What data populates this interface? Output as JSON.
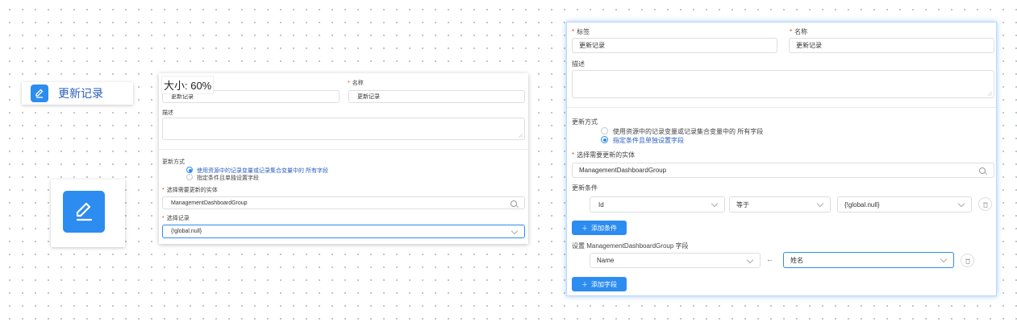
{
  "node_pill": {
    "label": "更新记录",
    "icon": "edit-icon"
  },
  "node_big": {
    "icon": "edit-icon"
  },
  "preview": {
    "zoom_label": "大小: 60%",
    "name_label": "名称",
    "label_value": "更新记录",
    "name_value": "更新记录",
    "description_label": "描述",
    "update_method_label": "更新方式",
    "option_all_fields": "使用资源中的记录变量或记录集合变量中的 所有字段",
    "option_specify": "指定条件且单独设置字段",
    "entity_label": "选择需要更新的实体",
    "entity_value": "ManagementDashboardGroup",
    "record_label": "选择记录",
    "record_value": "{!global.null}"
  },
  "editor": {
    "label_label": "标签",
    "label_value": "更新记录",
    "name_label": "名称",
    "name_value": "更新记录",
    "description_label": "描述",
    "update_method_label": "更新方式",
    "option_all_fields": "使用资源中的记录变量或记录集合变量中的 所有字段",
    "option_specify": "指定条件且单独设置字段",
    "entity_label": "选择需要更新的实体",
    "entity_value": "ManagementDashboardGroup",
    "condition_label": "更新条件",
    "condition_field": "Id",
    "condition_operator": "等于",
    "condition_value": "{!global.null}",
    "add_condition": "添加条件",
    "set_fields_label": "设置 ManagementDashboardGroup 字段",
    "set_field_target": "Name",
    "set_field_source": "姓名",
    "add_field": "添加字段"
  },
  "colors": {
    "accent": "#2d8cf0",
    "required": "#ed4014",
    "link_text": "#2b5fbf"
  }
}
